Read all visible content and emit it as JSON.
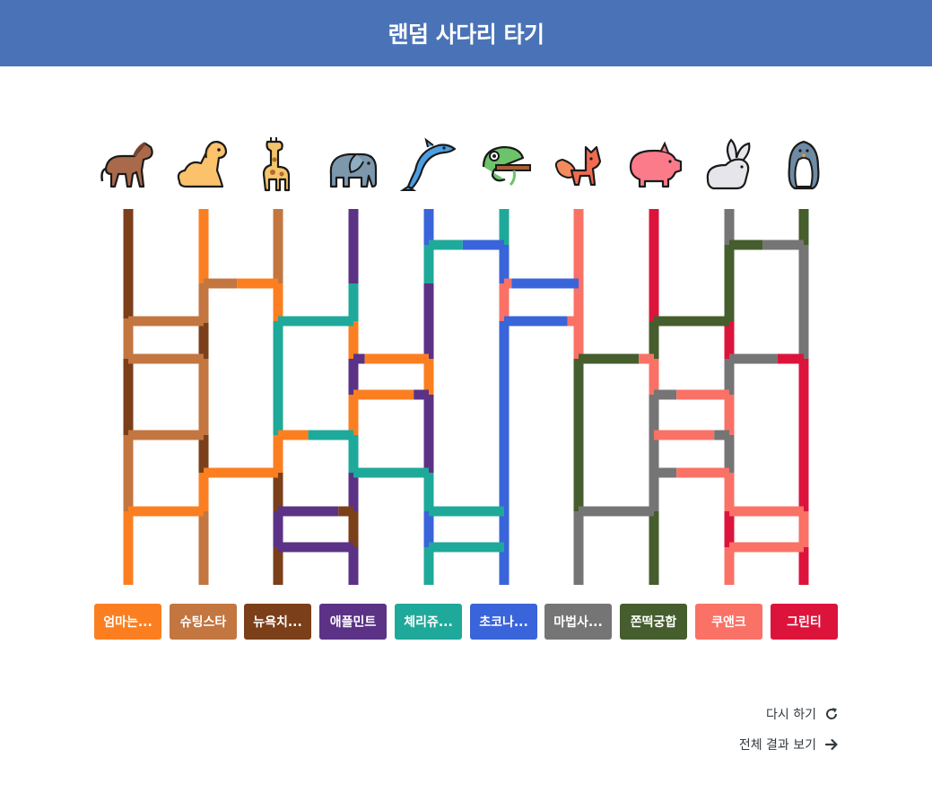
{
  "header": {
    "title": "랜덤 사다리 타기"
  },
  "animals": [
    "horse-icon",
    "dog-icon",
    "giraffe-icon",
    "elephant-icon",
    "dolphin-icon",
    "chameleon-icon",
    "fox-icon",
    "pig-icon",
    "rabbit-icon",
    "penguin-icon"
  ],
  "results": [
    {
      "label": "엄마는...",
      "color": "#fb7f21"
    },
    {
      "label": "슈팅스타",
      "color": "#c37640"
    },
    {
      "label": "뉴욕치...",
      "color": "#7b3f1a"
    },
    {
      "label": "애플민트",
      "color": "#5b3285"
    },
    {
      "label": "체리쥬...",
      "color": "#1fa99a"
    },
    {
      "label": "초코나...",
      "color": "#3a64d9"
    },
    {
      "label": "마법사...",
      "color": "#757575"
    },
    {
      "label": "쫀떡궁합",
      "color": "#465d2d"
    },
    {
      "label": "쿠앤크",
      "color": "#fa7166"
    },
    {
      "label": "그린티",
      "color": "#dc143c"
    }
  ],
  "actions": {
    "retry": "다시 하기",
    "all_results": "전체 결과 보기"
  }
}
